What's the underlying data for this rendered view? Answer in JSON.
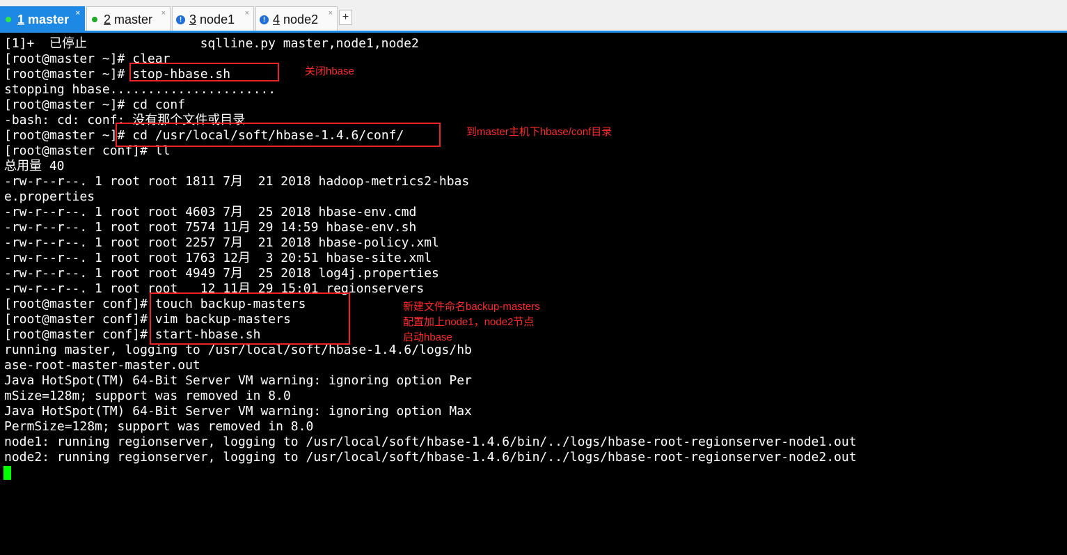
{
  "tabs": [
    {
      "number": "1",
      "name": "master",
      "status": "connected",
      "active": true
    },
    {
      "number": "2",
      "name": "master",
      "status": "connected",
      "active": false
    },
    {
      "number": "3",
      "name": "node1",
      "status": "warning",
      "active": false
    },
    {
      "number": "4",
      "name": "node2",
      "status": "warning",
      "active": false
    }
  ],
  "tab_close_icon": "×",
  "add_tab_icon": "+",
  "terminal": {
    "lines": [
      "[1]+  已停止               sqlline.py master,node1,node2",
      "[root@master ~]# clear",
      "[root@master ~]# stop-hbase.sh",
      "stopping hbase......................",
      "[root@master ~]# cd conf",
      "-bash: cd: conf: 没有那个文件或目录",
      "[root@master ~]# cd /usr/local/soft/hbase-1.4.6/conf/",
      "[root@master conf]# ll",
      "总用量 40",
      "-rw-r--r--. 1 root root 1811 7月  21 2018 hadoop-metrics2-hbas",
      "e.properties",
      "-rw-r--r--. 1 root root 4603 7月  25 2018 hbase-env.cmd",
      "-rw-r--r--. 1 root root 7574 11月 29 14:59 hbase-env.sh",
      "-rw-r--r--. 1 root root 2257 7月  21 2018 hbase-policy.xml",
      "-rw-r--r--. 1 root root 1763 12月  3 20:51 hbase-site.xml",
      "-rw-r--r--. 1 root root 4949 7月  25 2018 log4j.properties",
      "-rw-r--r--. 1 root root   12 11月 29 15:01 regionservers",
      "[root@master conf]# touch backup-masters",
      "[root@master conf]# vim backup-masters",
      "[root@master conf]# start-hbase.sh",
      "running master, logging to /usr/local/soft/hbase-1.4.6/logs/hb",
      "ase-root-master-master.out",
      "Java HotSpot(TM) 64-Bit Server VM warning: ignoring option Per",
      "mSize=128m; support was removed in 8.0",
      "Java HotSpot(TM) 64-Bit Server VM warning: ignoring option Max",
      "PermSize=128m; support was removed in 8.0",
      "node1: running regionserver, logging to /usr/local/soft/hbase-1.4.6/bin/../logs/hbase-root-regionserver-node1.out",
      "node2: running regionserver, logging to /usr/local/soft/hbase-1.4.6/bin/../logs/hbase-root-regionserver-node2.out"
    ]
  },
  "annotations": {
    "stop_hbase": "关闭hbase",
    "cd_conf": "到master主机下hbase/conf目录",
    "new_file": "新建文件命名backup-masters",
    "config_nodes": "配置加上node1，node2节点",
    "start_hbase": "启动hbase"
  },
  "colors": {
    "tab_active": "#1e88e5",
    "terminal_bg": "#000000",
    "terminal_fg": "#ffffff",
    "cursor": "#00ff00",
    "annotation": "#ff2a2a",
    "status_connected": "#1faa28",
    "status_warning": "#1e6fd9"
  }
}
